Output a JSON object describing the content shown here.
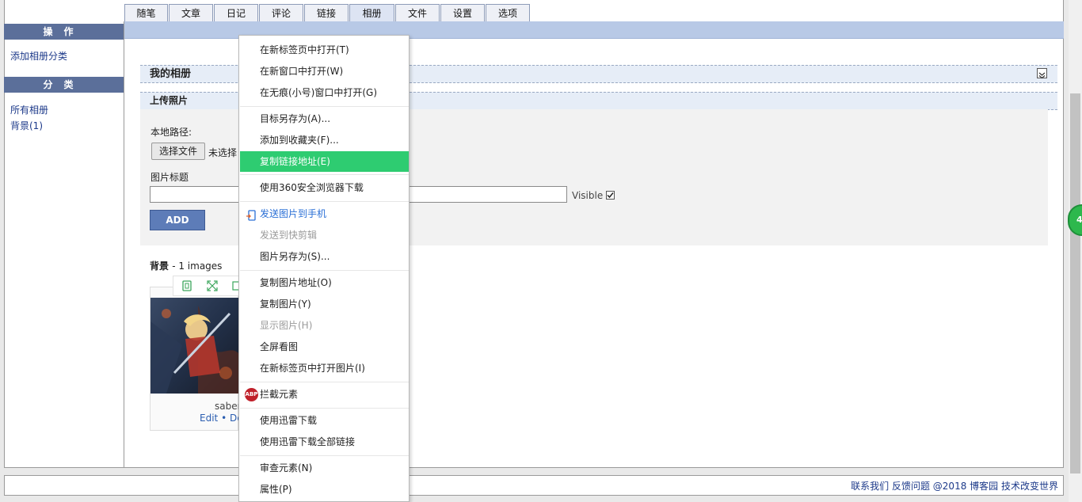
{
  "tabs": [
    "随笔",
    "文章",
    "日记",
    "评论",
    "链接",
    "相册",
    "文件",
    "设置",
    "选项"
  ],
  "sidebar": {
    "ops_title": "操作",
    "add_category": "添加相册分类",
    "cat_title": "分类",
    "all_albums": "所有相册",
    "bg_link": "背景(1)"
  },
  "main": {
    "my_albums": "我的相册",
    "upload_title": "上传照片",
    "local_path_label": "本地路径:",
    "choose_file": "选择文件",
    "no_file": "未选择",
    "photo_title_label": "图片标题",
    "visible_label": "Visible",
    "add_button": "ADD",
    "gallery_title": "背景",
    "gallery_count": "- 1 images",
    "image_caption": "saber",
    "edit_link": "Edit",
    "dot": "•",
    "delete_link": "De"
  },
  "context_menu": {
    "items": [
      "在新标签页中打开(T)",
      "在新窗口中打开(W)",
      "在无痕(小号)窗口中打开(G)",
      "目标另存为(A)...",
      "添加到收藏夹(F)...",
      "复制链接地址(E)",
      "使用360安全浏览器下载",
      "发送图片到手机",
      "发送到快剪辑",
      "图片另存为(S)...",
      "复制图片地址(O)",
      "复制图片(Y)",
      "显示图片(H)",
      "全屏看图",
      "在新标签页中打开图片(I)",
      "拦截元素",
      "使用迅雷下载",
      "使用迅雷下载全部链接",
      "审查元素(N)",
      "属性(P)"
    ],
    "abp_badge": "ABP"
  },
  "footer": {
    "contact": "联系我们",
    "feedback": "反馈问题",
    "copyright": "@2018 博客园",
    "slogan": "技术改变世界"
  },
  "side_bubble": "44",
  "colors": {
    "highlight": "#2ecc71",
    "nav_blue": "#b8c9e6",
    "side_head": "#5b6f9a",
    "link": "#1d3a8a"
  }
}
